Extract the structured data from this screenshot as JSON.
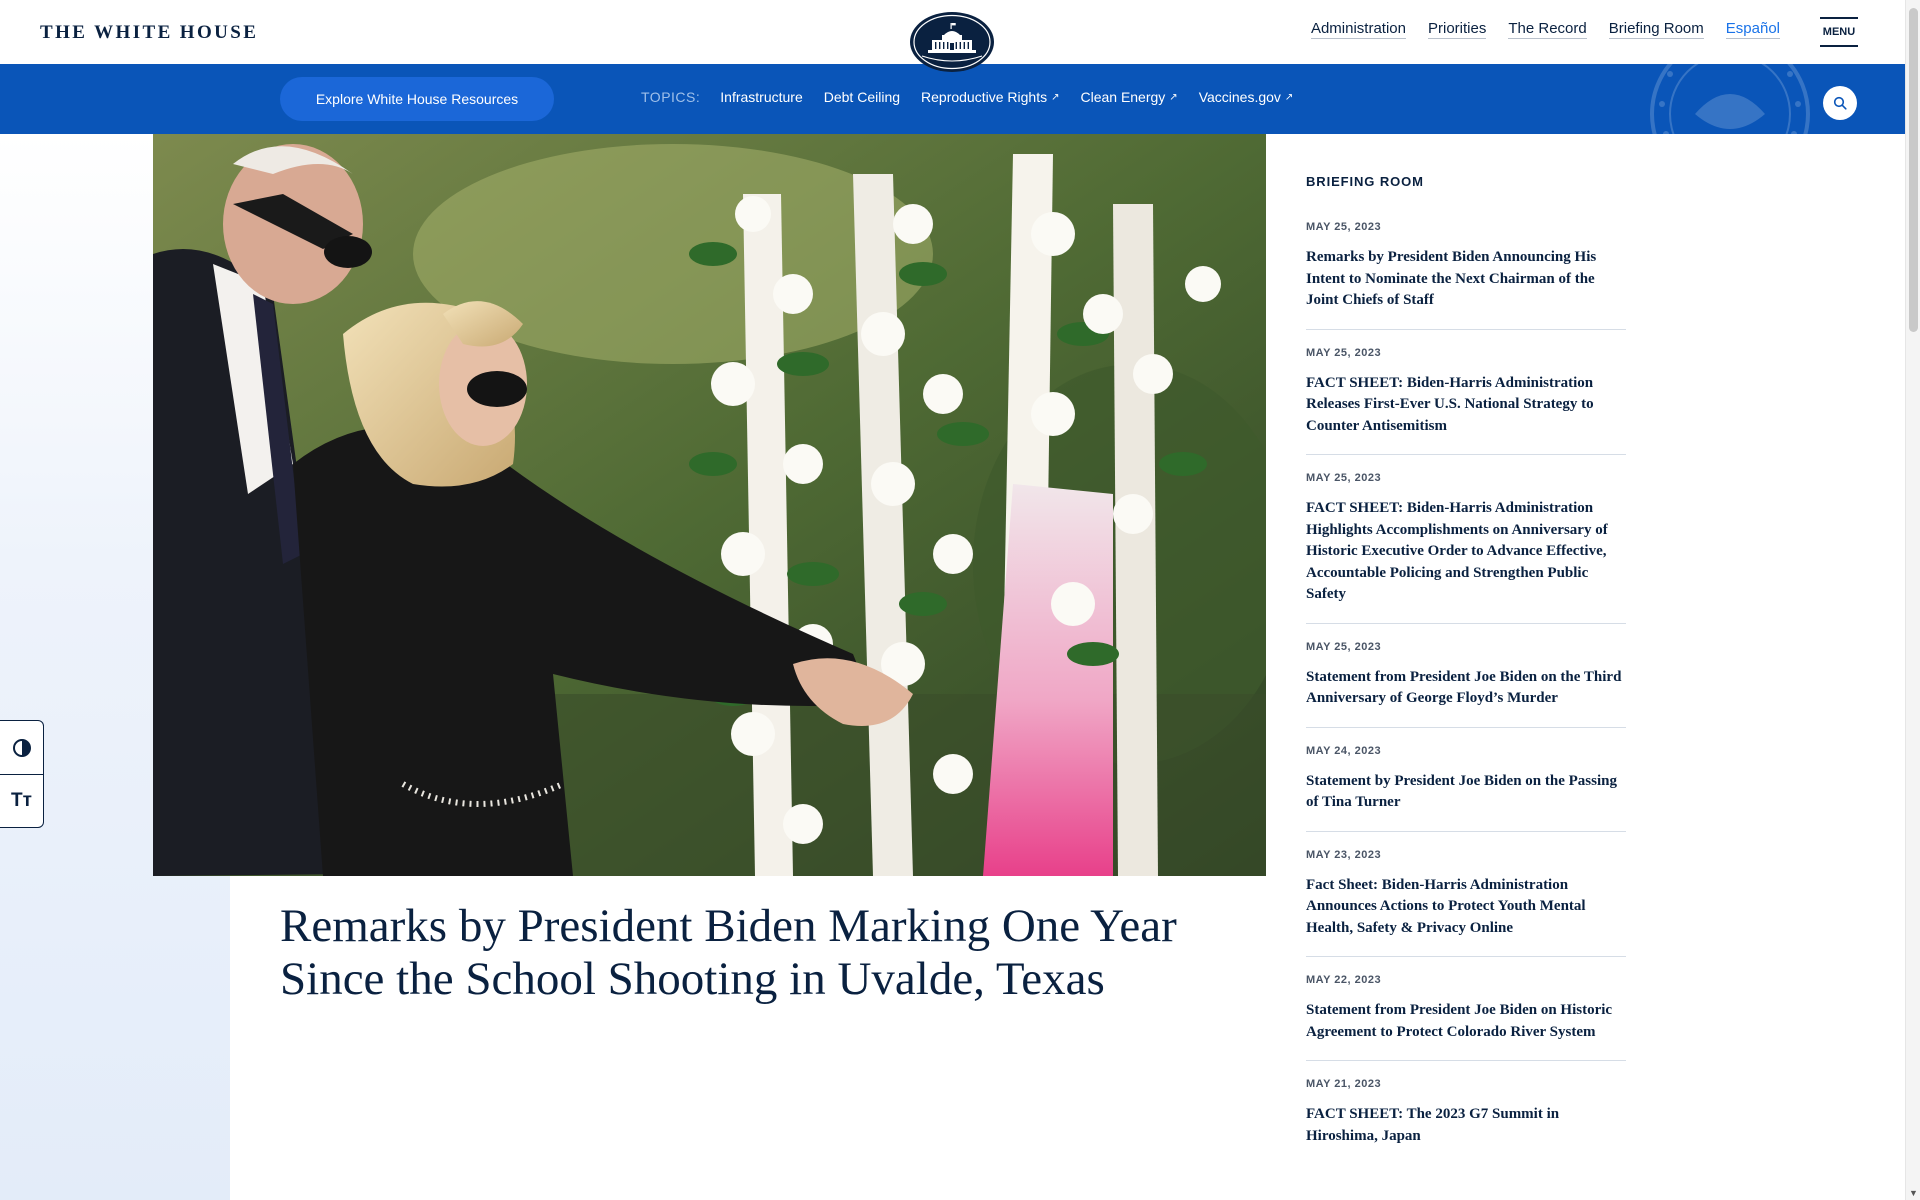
{
  "header": {
    "site_title": "THE WHITE HOUSE",
    "nav": [
      {
        "label": "Administration"
      },
      {
        "label": "Priorities"
      },
      {
        "label": "The Record"
      },
      {
        "label": "Briefing Room"
      },
      {
        "label": "Español"
      }
    ],
    "menu_label": "MENU"
  },
  "topic_bar": {
    "explore_label": "Explore White House Resources",
    "topics_label": "TOPICS:",
    "topics": [
      {
        "label": "Infrastructure",
        "external": ""
      },
      {
        "label": "Debt Ceiling",
        "external": ""
      },
      {
        "label": "Reproductive Rights",
        "external": "↗"
      },
      {
        "label": "Clean Energy",
        "external": "↗"
      },
      {
        "label": "Vaccines.gov",
        "external": "↗"
      }
    ]
  },
  "article": {
    "title": "Remarks by President Biden Marking One Year Since the School Shooting in Uvalde, Texas"
  },
  "briefing_room": {
    "heading": "BRIEFING ROOM",
    "items": [
      {
        "date": "MAY 25, 2023",
        "title": "Remarks by President Biden Announcing His Intent to Nominate the Next Chairman of the Joint Chiefs of Staff"
      },
      {
        "date": "MAY 25, 2023",
        "title": "FACT SHEET: Biden-Harris Administration Releases First-Ever U.S. National Strategy to Counter Antisemitism"
      },
      {
        "date": "MAY 25, 2023",
        "title": "FACT SHEET: Biden-Harris Administration Highlights Accomplishments on Anniversary of Historic Executive Order to Advance Effective, Accountable Policing and Strengthen Public Safety"
      },
      {
        "date": "MAY 25, 2023",
        "title": "Statement from President Joe Biden on the Third Anniversary of George Floyd’s Murder"
      },
      {
        "date": "MAY 24, 2023",
        "title": "Statement by President Joe Biden on the Passing of Tina Turner"
      },
      {
        "date": "MAY 23, 2023",
        "title": "Fact Sheet: Biden-Harris Administration Announces Actions to Protect Youth Mental Health, Safety & Privacy Online"
      },
      {
        "date": "MAY 22, 2023",
        "title": "Statement from President Joe Biden on Historic Agreement to Protect Colorado River System"
      },
      {
        "date": "MAY 21, 2023",
        "title": "FACT SHEET: The 2023 G7 Summit in Hiroshima, Japan"
      }
    ]
  },
  "accessibility": {
    "text_size_glyph": "Tт"
  },
  "colors": {
    "navy": "#0a2140",
    "topic_bar": "#0a55b8",
    "explore_button": "#1b67d8",
    "espanol_link": "#1a73e8",
    "ribbon_pink": "#e8408a"
  },
  "icons": {
    "seal": "white-house-seal-icon",
    "search": "search-icon",
    "contrast": "contrast-icon",
    "text_size": "text-size-icon",
    "external": "external-link-icon"
  }
}
